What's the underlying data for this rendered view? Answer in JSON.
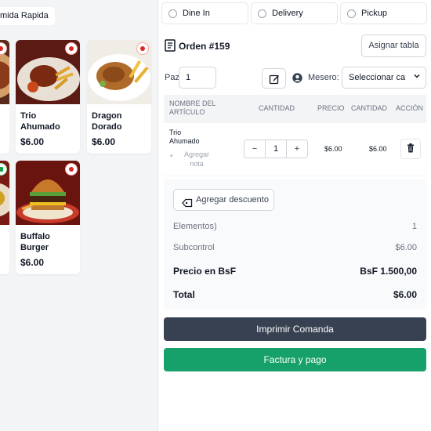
{
  "menu": {
    "category_chip": "mida Rapida",
    "items": [
      {
        "name": "Trio Ahumado",
        "price": "$6.00"
      },
      {
        "name": "Dragon Dorado",
        "price": "$6.00"
      },
      {
        "name": "Buffalo Burger",
        "price": "$6.00"
      }
    ]
  },
  "order_types": [
    "Dine In",
    "Delivery",
    "Pickup"
  ],
  "order": {
    "title": "Orden #159",
    "assign_table": "Asignar tabla",
    "pax_label": "Paz",
    "pax_value": "1",
    "waiter_label": "Mesero:",
    "waiter_select": "Seleccionar ca"
  },
  "table": {
    "headers": {
      "name": "NOMBRE DEL ARTÍCULO",
      "qty": "CANTIDAD",
      "price": "PRECIO",
      "amount": "CANTIDAD",
      "action": "ACCIÓN"
    },
    "rows": [
      {
        "name": "Trio Ahumado",
        "add_note": "Agregar nota",
        "qty": "1",
        "price": "$6.00",
        "amount": "$6.00"
      }
    ]
  },
  "summary": {
    "discount_button": "Agregar descuento",
    "items_label": "Elementos)",
    "items_value": "1",
    "subtotal_label": "Subcontrol",
    "subtotal_value": "$6.00",
    "bsf_label": "Precio en BsF",
    "bsf_value": "BsF 1.500,00",
    "total_label": "Total",
    "total_value": "$6.00"
  },
  "actions": {
    "print_kot": "Imprimir Comanda",
    "bill_pay": "Factura y pago"
  },
  "colors": {
    "dark_button": "#374151",
    "green_button": "#16a06a",
    "non_veg_badge": "#dc2626",
    "veg_badge": "#16a34a"
  }
}
